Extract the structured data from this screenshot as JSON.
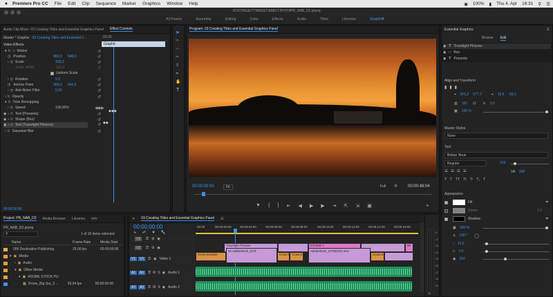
{
  "menubar": {
    "apple": "",
    "app": "Premiere Pro CC",
    "items": [
      "File",
      "Edit",
      "Clip",
      "Sequence",
      "Marker",
      "Graphics",
      "Window",
      "Help"
    ],
    "status": {
      "battery": "100%",
      "date": "Thu 4. Apr",
      "time": "16:31"
    }
  },
  "titlebar": {
    "path": "/FOOTAGE/TTWASST.RAB1T.PHYH/PR_NAB_D2.prproj",
    "workspaces": [
      "All Panels",
      "Assembly",
      "Editing",
      "Color",
      "Effects",
      "Audio",
      "Titles",
      "Libraries",
      "Graphics"
    ],
    "active_workspace": "Graphics",
    "more": "»"
  },
  "effect_controls": {
    "tabs": [
      "Audio Clip Mixer: 03 Creating Titles and Essential Graphics Panel",
      "Effect Controls"
    ],
    "header_left": "Master * Graphic",
    "header_seq": "03 Creating Titles and Essential C...",
    "ruler_start": "00:00",
    "graphic_bar": "Graphic",
    "video_effects": "Video Effects",
    "rows": [
      {
        "label": "Motion",
        "value": "",
        "kind": "fx"
      },
      {
        "label": "Position",
        "value": "960,0",
        "value2": "540,0",
        "kind": "param"
      },
      {
        "label": "Scale",
        "value": "100,0",
        "kind": "param"
      },
      {
        "label": "Scale Width",
        "value": "100,0",
        "kind": "param-dim"
      },
      {
        "label": "Uniform Scale",
        "kind": "checkbox"
      },
      {
        "label": "Rotation",
        "value": "0,0",
        "kind": "param"
      },
      {
        "label": "Anchor Point",
        "value": "960,0",
        "value2": "540,0",
        "kind": "param"
      },
      {
        "label": "Anti-flicker Filter",
        "value": "0,00",
        "kind": "param"
      },
      {
        "label": "Opacity",
        "kind": "fx"
      },
      {
        "label": "Time Remapping",
        "kind": "fx"
      },
      {
        "label": "Speed",
        "value": "100,00%",
        "kind": "param"
      },
      {
        "label": "Text (Presents)",
        "kind": "fx"
      },
      {
        "label": "Shape (Box)",
        "kind": "fx"
      },
      {
        "label": "Text (Travelight Pictures)",
        "kind": "fx-selected"
      },
      {
        "label": "Gaussian Blur",
        "kind": "fx"
      }
    ],
    "timecode": "00:00:00:00"
  },
  "tools": [
    "selection-tool",
    "track-select-tool",
    "ripple-edit-tool",
    "razor-tool",
    "slip-tool",
    "pen-tool",
    "hand-tool",
    "type-tool"
  ],
  "program": {
    "title": "Program: 03 Creating Titles and Essential Graphics Panel",
    "timecode": "00:00:00:00",
    "fit": "Fit",
    "quality": "Full",
    "duration": "00:00:48:04",
    "controls": [
      "marker",
      "in-point",
      "out-point",
      "go-to-in",
      "step-back",
      "play",
      "step-forward",
      "go-to-out",
      "insert",
      "overwrite",
      "export-frame",
      "add"
    ]
  },
  "essential_graphics": {
    "title": "Essential Graphics",
    "tabs": [
      "Browse",
      "Edit"
    ],
    "active_tab": "Edit",
    "layers": [
      "Travelight Pictures",
      "Box",
      "Presents"
    ],
    "align_title": "Align and Transform",
    "position": [
      "971,2",
      "577,7"
    ],
    "anchor": [
      "10,5",
      "-53,1"
    ],
    "scale": "100",
    "rotation": "0,0",
    "opacity": "100 %",
    "master_styles_title": "Master Styles",
    "master_style_value": "None",
    "text_title": "Text",
    "font": "Bebas Neue",
    "font_style": "Regular",
    "font_size": "123",
    "tracking": "900",
    "appearance_title": "Appearance",
    "fill_label": "Fill",
    "fill_color": "#ffffff",
    "stroke_label": "Stroke",
    "stroke_value": "1,0",
    "shadow_label": "Shadow",
    "shadow_color": "#000000",
    "shadow_values": [
      "100 %",
      "135 °",
      "10,0",
      "7,0",
      "210"
    ]
  },
  "project": {
    "tabs": [
      "Project: PR_NAB_D2",
      "Media Browser",
      "Libraries",
      "Info"
    ],
    "file": "PR_NAB_D2.prproj",
    "selection_count": "1 of 15 items selected",
    "columns": [
      "Name",
      "Frame Rate",
      "Media Start"
    ],
    "items": [
      {
        "name": "006 Destination Publishing",
        "rate": "25,00 fps",
        "start": "00:00:00:00",
        "color": "#e6b43c"
      },
      {
        "name": "Media",
        "rate": "",
        "start": "",
        "color": "#e6a13c"
      },
      {
        "name": "Audio",
        "rate": "",
        "start": "",
        "color": "#e6a13c"
      },
      {
        "name": "Other Media",
        "rate": "",
        "start": "",
        "color": "#e6a13c"
      },
      {
        "name": "ADOBE STOCK PU",
        "rate": "",
        "start": "",
        "color": "#e6a13c"
      },
      {
        "name": "Drone_Big Sur_2...",
        "rate": "59,94 fps",
        "start": "00:00:00:00",
        "color": "#4a8fe0"
      }
    ]
  },
  "timeline": {
    "title": "03 Creating Titles and Essential Graphics Panel",
    "timecode": "00:00:00:00",
    "ruler": [
      "00:00",
      "00:00:02:00",
      "00:00:04:00",
      "00:00:06:00",
      "00:00:08:00",
      "00:00:10:00",
      "00:00:12:00",
      "00:00:14:00",
      "00:00:16:00"
    ],
    "tracks": [
      "V3",
      "V2",
      "V1",
      "A1",
      "A2",
      "A3"
    ],
    "track_labels": {
      "v1": "Video 1",
      "a1": "Audio 1",
      "a2": "Audio 2"
    },
    "clips": {
      "title": "Travelight Pictures",
      "stock1": "04 AdobeStock_1175",
      "studio": "STUDIO 7",
      "stock2": "AdobeStock_117932211.mov",
      "pink_short": "05",
      "cross1": "Cross Dissolve",
      "cross2": "Cross D",
      "cross3": "Cross D",
      "cross4": "Cross D",
      "fx1": "Cross Dissolve"
    },
    "meter_labels": [
      "-6",
      "-12",
      "-18",
      "-24",
      "-30",
      "-36",
      "-42",
      "-48",
      "-54"
    ],
    "meter_footer": "dB"
  }
}
